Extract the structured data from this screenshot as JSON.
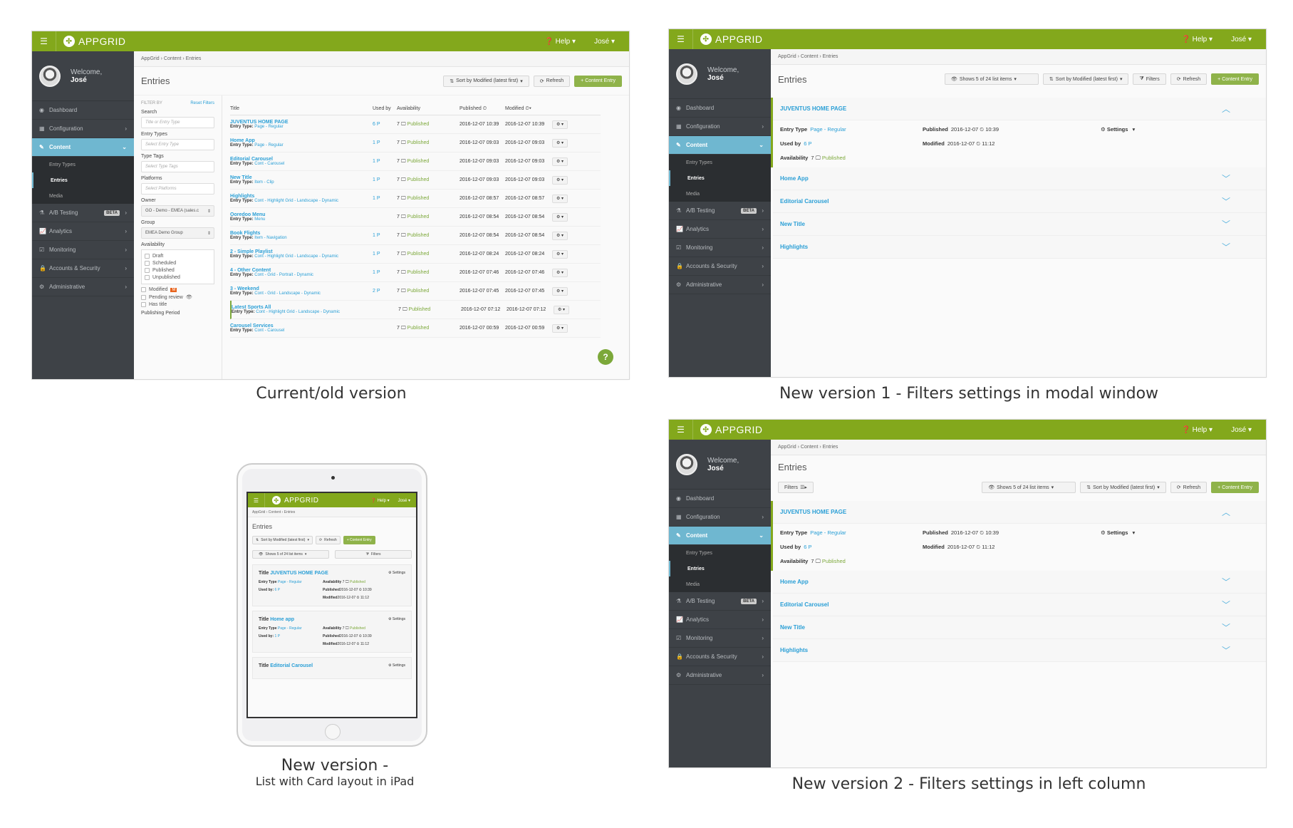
{
  "app": {
    "brand": "APPGRID",
    "help": "Help",
    "user": "José",
    "welcome": "Welcome,",
    "breadcrumb": "AppGrid › Content › Entries",
    "page_title": "Entries"
  },
  "sidebar": {
    "items": [
      {
        "label": "Dashboard",
        "icon": "dashboard-icon",
        "glyph": "◉"
      },
      {
        "label": "Configuration",
        "icon": "grid-icon",
        "glyph": "▦"
      },
      {
        "label": "Content",
        "icon": "pencil-icon",
        "glyph": "✎"
      },
      {
        "label": "A/B Testing",
        "icon": "flask-icon",
        "glyph": "⚗",
        "badge": "BETA"
      },
      {
        "label": "Analytics",
        "icon": "chart-icon",
        "glyph": "📈"
      },
      {
        "label": "Monitoring",
        "icon": "check-icon",
        "glyph": "☑"
      },
      {
        "label": "Accounts & Security",
        "icon": "lock-icon",
        "glyph": "🔒"
      },
      {
        "label": "Administrative",
        "icon": "cogs-icon",
        "glyph": "⚙"
      }
    ],
    "sub_items": [
      "Entry Types",
      "Entries",
      "Media"
    ]
  },
  "toolbar": {
    "sort": "Sort by Modified (latest first)",
    "refresh": "Refresh",
    "add": "+ Content Entry",
    "shows": "Shows 5 of 24 list items",
    "filters": "Filters"
  },
  "old_filters": {
    "header": "FILTER BY",
    "reset": "Reset Filters",
    "search_label": "Search",
    "search_placeholder": "Title or Entry Type",
    "types_label": "Entry Types",
    "types_placeholder": "Select Entry Type",
    "tags_label": "Type Tags",
    "tags_placeholder": "Select Type Tags",
    "platforms_label": "Platforms",
    "platforms_placeholder": "Select Platforms",
    "owner_label": "Owner",
    "owner_value": "GO - Demo - EMEA (sales.c",
    "group_label": "Group",
    "group_value": "EMEA Demo Group",
    "availability_label": "Availability",
    "availability": [
      "Draft",
      "Scheduled",
      "Published",
      "Unpublished"
    ],
    "extra": [
      "Modified",
      "Pending review",
      "Has title"
    ],
    "modified_badge": "M",
    "publishing_period": "Publishing Period"
  },
  "table": {
    "headers": [
      "Title",
      "Used by",
      "Availability",
      "Published",
      "Modified"
    ],
    "type_prefix": "Entry Type:",
    "rows": [
      {
        "title": "JUVENTUS HOME PAGE",
        "type": "Page - Regular",
        "used": "6",
        "avail": "7",
        "status": "Published",
        "published": "2016-12-07 10:39",
        "modified": "2016-12-07 10:39"
      },
      {
        "title": "Home App",
        "type": "Page - Regular",
        "used": "1",
        "avail": "7",
        "status": "Published",
        "published": "2016-12-07 09:03",
        "modified": "2016-12-07 09:03"
      },
      {
        "title": "Editorial Carousel",
        "type": "Cont - Carousel",
        "used": "1",
        "avail": "7",
        "status": "Published",
        "published": "2016-12-07 09:03",
        "modified": "2016-12-07 09:03"
      },
      {
        "title": "New Title",
        "type": "Item - Clip",
        "used": "1",
        "avail": "7",
        "status": "Published",
        "published": "2016-12-07 09:03",
        "modified": "2016-12-07 09:03"
      },
      {
        "title": "Highlights",
        "type": "Cont - Highlight Grid - Landscape - Dynamic",
        "used": "1",
        "avail": "7",
        "status": "Published",
        "published": "2016-12-07 08:57",
        "modified": "2016-12-07 08:57"
      },
      {
        "title": "Ooredoo Menu",
        "type": "Menu",
        "used": "",
        "avail": "7",
        "status": "Published",
        "published": "2016-12-07 08:54",
        "modified": "2016-12-07 08:54"
      },
      {
        "title": "Book Flights",
        "type": "Item - Navigation",
        "used": "1",
        "avail": "7",
        "status": "Published",
        "published": "2016-12-07 08:54",
        "modified": "2016-12-07 08:54"
      },
      {
        "title": "2 - Simple Playlist",
        "type": "Cont - Highlight Grid - Landscape - Dynamic",
        "used": "1",
        "avail": "7",
        "status": "Published",
        "published": "2016-12-07 08:24",
        "modified": "2016-12-07 08:24"
      },
      {
        "title": "4 - Other Content",
        "type": "Cont - Grid - Portrait - Dynamic",
        "used": "1",
        "avail": "7",
        "status": "Published",
        "published": "2016-12-07 07:46",
        "modified": "2016-12-07 07:46"
      },
      {
        "title": "3 - Weekend",
        "type": "Cont - Grid - Landscape - Dynamic",
        "used": "2",
        "avail": "7",
        "status": "Published",
        "published": "2016-12-07 07:45",
        "modified": "2016-12-07 07:45"
      },
      {
        "title": "Latest Sports All",
        "type": "Cont - Highlight Grid - Landscape - Dynamic",
        "used": "",
        "avail": "7",
        "status": "Published",
        "published": "2016-12-07 07:12",
        "modified": "2016-12-07 07:12"
      },
      {
        "title": "Carousel Services",
        "type": "Cont - Carousel",
        "used": "",
        "avail": "7",
        "status": "Published",
        "published": "2016-12-07 00:59",
        "modified": "2016-12-07 00:59"
      }
    ]
  },
  "expanded": {
    "title": "JUVENTUS HOME PAGE",
    "entry_type_label": "Entry Type",
    "entry_type": "Page - Regular",
    "used_by_label": "Used by",
    "used_by": "6 P",
    "availability_label": "Availability",
    "availability": "7",
    "status": "Published",
    "published_label": "Published",
    "published_date": "2016-12-07",
    "published_time": "10:39",
    "modified_label": "Modified",
    "modified_date": "2016-12-07",
    "modified_time": "11:12",
    "settings": "Settings"
  },
  "collapsed": [
    "Home App",
    "Editorial Carousel",
    "New Title",
    "Highlights"
  ],
  "ipad": {
    "title_label": "Title",
    "used_by_label": "Used by:",
    "cards": [
      {
        "title": "JUVENTUS HOME PAGE",
        "type": "Page - Regular",
        "used": "6 P",
        "avail": "7",
        "status": "Published",
        "pub": "2016-12-07",
        "pub_t": "10:39",
        "mod": "2016-12-07",
        "mod_t": "11:12"
      },
      {
        "title": "Home app",
        "type": "Page - Regular",
        "used": "1 P",
        "avail": "7",
        "status": "Published",
        "pub": "2016-12-07",
        "pub_t": "10:39",
        "mod": "2016-12-07",
        "mod_t": "11:12"
      },
      {
        "title": "Editorial Carousel"
      }
    ]
  },
  "captions": {
    "old": "Current/old version",
    "v1": "New version 1 - Filters settings in modal window",
    "ipad_1": "New version -",
    "ipad_2": "List with Card layout in iPad",
    "v2": "New version 2 - Filters settings in left column"
  }
}
